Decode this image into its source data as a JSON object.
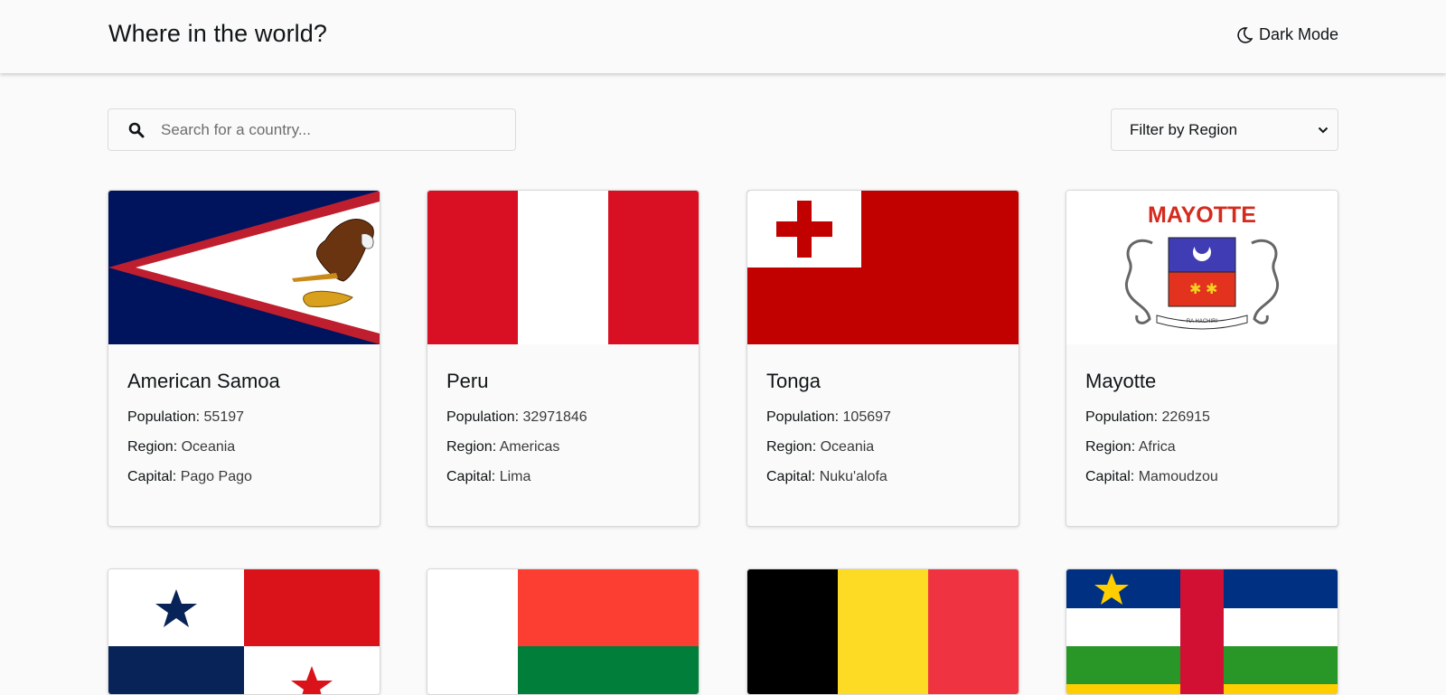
{
  "header": {
    "title": "Where in the world?",
    "mode_label": "Dark Mode",
    "mode_icon": "moon-icon"
  },
  "search": {
    "placeholder": "Search for a country...",
    "value": "",
    "icon": "search-icon"
  },
  "filter": {
    "label": "Filter by Region",
    "icon": "chevron-down-icon"
  },
  "labels": {
    "population": "Population:",
    "region": "Region:",
    "capital": "Capital:"
  },
  "countries": [
    {
      "name": "American Samoa",
      "population": "55197",
      "region": "Oceania",
      "capital": "Pago Pago",
      "flag": "american-samoa-flag"
    },
    {
      "name": "Peru",
      "population": "32971846",
      "region": "Americas",
      "capital": "Lima",
      "flag": "peru-flag"
    },
    {
      "name": "Tonga",
      "population": "105697",
      "region": "Oceania",
      "capital": "Nuku'alofa",
      "flag": "tonga-flag"
    },
    {
      "name": "Mayotte",
      "population": "226915",
      "region": "Africa",
      "capital": "Mamoudzou",
      "flag": "mayotte-flag",
      "flag_text": "MAYOTTE",
      "flag_motto": "RA HACHIRI"
    }
  ],
  "partial_cards": [
    {
      "flag": "panama-flag"
    },
    {
      "flag": "madagascar-flag"
    },
    {
      "flag": "belgium-flag"
    },
    {
      "flag": "central-african-republic-flag"
    }
  ]
}
